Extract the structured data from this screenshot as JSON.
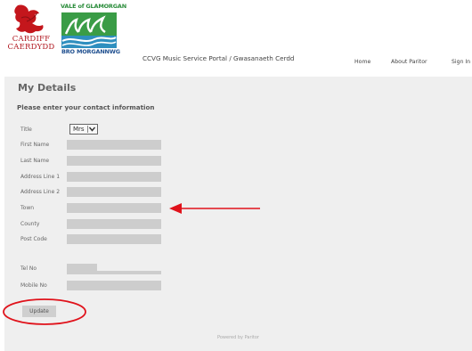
{
  "header": {
    "cardiff_logo_text_en": "CARDIFF",
    "cardiff_logo_text_cy": "CAERDYDD",
    "vale_logo_text_top": "VALE of GLAMORGAN",
    "vale_logo_text_bottom": "BRO MORGANNWG",
    "portal_title": "CCVG Music Service Portal / Gwasanaeth Cerdd",
    "nav": {
      "home": "Home",
      "about": "About Paritor",
      "signin": "Sign In"
    }
  },
  "page": {
    "title": "My Details",
    "subtitle": "Please enter your contact information"
  },
  "form": {
    "title_label": "Title",
    "title_value": "Mrs",
    "fields": [
      {
        "label": "First Name",
        "value": ""
      },
      {
        "label": "Last Name",
        "value": ""
      },
      {
        "label": "Address Line 1",
        "value": ""
      },
      {
        "label": "Address Line 2",
        "value": ""
      },
      {
        "label": "Town",
        "value": ""
      },
      {
        "label": "County",
        "value": ""
      },
      {
        "label": "Post Code",
        "value": ""
      }
    ],
    "tel_label": "Tel No",
    "mobile_label": "Mobile No",
    "update_label": "Update"
  },
  "footer": {
    "text": "Powered by Paritor"
  },
  "colors": {
    "panel_bg": "#efefef",
    "input_bg": "#cdcdcd",
    "annotation": "#e0121b",
    "cardiff_red": "#b0171f",
    "vale_green": "#2a8c3a",
    "vale_blue": "#1f4f8f"
  }
}
